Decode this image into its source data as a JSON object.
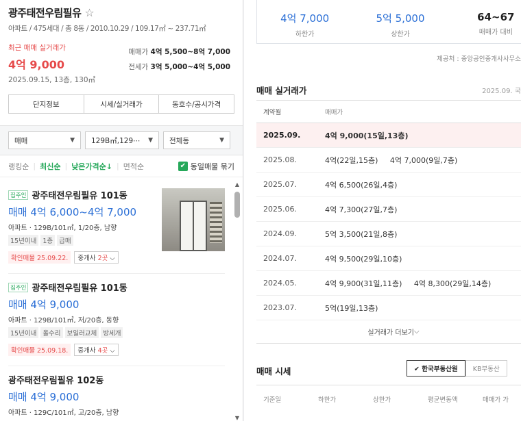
{
  "complex": {
    "name": "광주태전우림필유",
    "info": "아파트 / 475세대 / 총 8동 / 2010.10.29 / 109.17㎡ ~ 237.71㎡",
    "recent_label": "최근 매매 실거래가",
    "recent_price": "4억 9,000",
    "recent_sub": "2025.09.15, 13층, 130㎡",
    "sale_range_label": "매매가",
    "sale_range": "4억 5,500~8억 7,000",
    "jeonse_range_label": "전세가",
    "jeonse_range": "3억 5,000~4억 5,000"
  },
  "info_tabs": [
    "단지정보",
    "시세/실거래가",
    "동호수/공시가격"
  ],
  "filters": {
    "trade_type": "매매",
    "area": "129B㎡,129⋯",
    "dong": "전체동"
  },
  "sort": {
    "options": [
      "랭킹순",
      "최신순",
      "낮은가격순↓",
      "면적순"
    ],
    "active": [
      "최신순",
      "낮은가격순↓"
    ],
    "same_listing_label": "동일매물 묶기"
  },
  "listings": [
    {
      "owner_tag": "집주인",
      "title": "광주태전우림필유 101동",
      "price": "매매 4억 6,000~4억 7,000",
      "spec": "아파트 · 129B/101㎡, 1/20층, 남향",
      "tags": [
        "15년이내",
        "1층",
        "급매"
      ],
      "confirm": "확인매물 25.09.22.",
      "agent_label": "중개사",
      "agent_count": "2곳"
    },
    {
      "owner_tag": "집주인",
      "title": "광주태전우림필유 101동",
      "price": "매매 4억 9,000",
      "spec": "아파트 · 129B/101㎡, 저/20층, 동향",
      "tags": [
        "15년이내",
        "올수리",
        "보일러교체",
        "방세개"
      ],
      "confirm": "확인매물 25.09.18.",
      "agent_label": "중개사",
      "agent_count": "4곳"
    },
    {
      "owner_tag": "",
      "title": "광주태전우림필유 102동",
      "price": "매매 4억 9,000",
      "spec": "아파트 · 129C/101㎡, 고/20층, 남향",
      "tags": [],
      "confirm": "",
      "agent_label": "",
      "agent_count": ""
    }
  ],
  "stats": [
    {
      "value": "4억 7,000",
      "label": "하한가"
    },
    {
      "value": "5억 5,000",
      "label": "상한가"
    },
    {
      "value": "64~67",
      "label": "매매가 대비"
    }
  ],
  "provider": "제공처 : 중앙공인중개사사무소",
  "real_trade": {
    "title": "매매 실거래가",
    "date": "2025.09. 국",
    "col_month": "계약월",
    "col_price": "매매가",
    "rows": [
      {
        "month": "2025.09.",
        "price": "4억 9,000(15일,13층)",
        "highlight": true
      },
      {
        "month": "2025.08.",
        "price": "4억(22일,15층)     4억 7,000(9일,7층)",
        "highlight": false
      },
      {
        "month": "2025.07.",
        "price": "4억 6,500(26일,4층)",
        "highlight": false
      },
      {
        "month": "2025.06.",
        "price": "4억 7,300(27일,7층)",
        "highlight": false
      },
      {
        "month": "2024.09.",
        "price": "5억 3,500(21일,8층)",
        "highlight": false
      },
      {
        "month": "2024.07.",
        "price": "4억 9,500(29일,10층)",
        "highlight": false
      },
      {
        "month": "2024.05.",
        "price": "4억 9,900(31일,11층)     4억 8,300(29일,14층)",
        "highlight": false
      },
      {
        "month": "2023.07.",
        "price": "5억(19일,13층)",
        "highlight": false
      }
    ],
    "more_label": "실거래가 더보기"
  },
  "market": {
    "title": "매매 시세",
    "sources": [
      "✔ 한국부동산원",
      "KB부동산"
    ],
    "columns": [
      "기준일",
      "하한가",
      "상한가",
      "평균변동액",
      "매매가 가"
    ]
  }
}
